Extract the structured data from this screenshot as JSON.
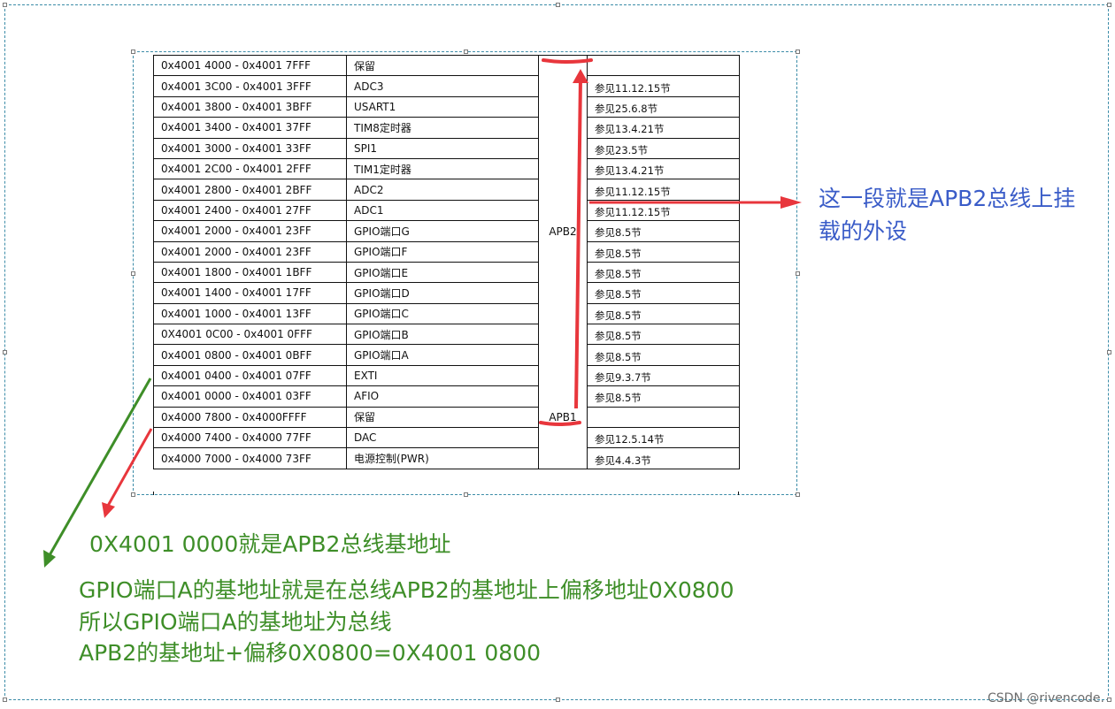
{
  "table": {
    "rows": [
      {
        "range": "0x4001 4000 - 0x4001 7FFF",
        "peripheral": "保留",
        "ref": ""
      },
      {
        "range": "0x4001 3C00 - 0x4001 3FFF",
        "peripheral": "ADC3",
        "ref": "参见11.12.15节"
      },
      {
        "range": "0x4001 3800 - 0x4001 3BFF",
        "peripheral": "USART1",
        "ref": "参见25.6.8节"
      },
      {
        "range": "0x4001 3400 - 0x4001 37FF",
        "peripheral": "TIM8定时器",
        "ref": "参见13.4.21节"
      },
      {
        "range": "0x4001 3000 - 0x4001 33FF",
        "peripheral": "SPI1",
        "ref": "参见23.5节"
      },
      {
        "range": "0x4001 2C00 - 0x4001 2FFF",
        "peripheral": "TIM1定时器",
        "ref": "参见13.4.21节"
      },
      {
        "range": "0x4001 2800 - 0x4001 2BFF",
        "peripheral": "ADC2",
        "ref": "参见11.12.15节"
      },
      {
        "range": "0x4001 2400 - 0x4001 27FF",
        "peripheral": "ADC1",
        "ref": "参见11.12.15节"
      },
      {
        "range": "0x4001 2000 - 0x4001 23FF",
        "peripheral": "GPIO端口G",
        "ref": "参见8.5节"
      },
      {
        "range": "0x4001 2000 - 0x4001 23FF",
        "peripheral": "GPIO端口F",
        "ref": "参见8.5节"
      },
      {
        "range": "0x4001 1800 - 0x4001 1BFF",
        "peripheral": "GPIO端口E",
        "ref": "参见8.5节"
      },
      {
        "range": "0x4001 1400 - 0x4001 17FF",
        "peripheral": "GPIO端口D",
        "ref": "参见8.5节"
      },
      {
        "range": "0x4001 1000 - 0x4001 13FF",
        "peripheral": "GPIO端口C",
        "ref": "参见8.5节"
      },
      {
        "range": "0X4001 0C00 - 0x4001 0FFF",
        "peripheral": "GPIO端口B",
        "ref": "参见8.5节"
      },
      {
        "range": "0x4001 0800 - 0x4001 0BFF",
        "peripheral": "GPIO端口A",
        "ref": "参见8.5节"
      },
      {
        "range": "0x4001 0400 - 0x4001 07FF",
        "peripheral": "EXTI",
        "ref": "参见9.3.7节"
      },
      {
        "range": "0x4001 0000 - 0x4001 03FF",
        "peripheral": "AFIO",
        "ref": "参见8.5节"
      },
      {
        "range": "0x4000 7800 - 0x4000FFFF",
        "peripheral": "保留",
        "ref": ""
      },
      {
        "range": "0x4000 7400 - 0x4000 77FF",
        "peripheral": "DAC",
        "ref": "参见12.5.14节"
      },
      {
        "range": "0x4000 7000 - 0x4000 73FF",
        "peripheral": "电源控制(PWR)",
        "ref": "参见4.4.3节"
      }
    ],
    "bus_apb2": "APB2",
    "bus_apb1": "APB1"
  },
  "annotations": {
    "right_note_line1": "这一段就是APB2总线上挂",
    "right_note_line2": "载的外设",
    "base_address_note": "0X4001 0000就是APB2总线基地址",
    "explain_line1": "GPIO端口A的基地址就是在总线APB2的基地址上偏移地址0X0800",
    "explain_line2": "所以GPIO端口A的基地址为总线",
    "explain_line3": "APB2的基地址+偏移0X0800=0X4001 0800",
    "colors": {
      "red": "#e8363c",
      "green": "#3e8e28",
      "blue": "#3a5cc8"
    }
  },
  "watermark": "CSDN @rivencode."
}
